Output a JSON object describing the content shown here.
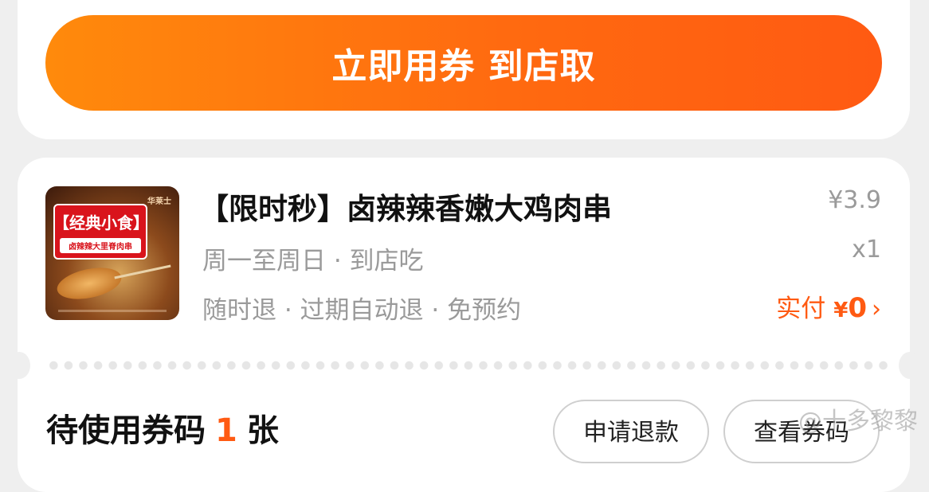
{
  "cta": {
    "label": "立即用券 到店取"
  },
  "product": {
    "title": "【限时秒】卤辣辣香嫩大鸡肉串",
    "schedule": "周一至周日 · 到店吃",
    "policy": "随时退 · 过期自动退 · 免预约",
    "price": "¥3.9",
    "quantity": "x1",
    "paid_label": "实付",
    "paid_currency": "¥",
    "paid_amount": "0",
    "thumbnail": {
      "brand": "华莱士",
      "tag_title": "【经典小食】",
      "tag_subtitle": "卤辣辣大里脊肉串"
    }
  },
  "codes": {
    "pending_prefix": "待使用券码",
    "pending_count": "1",
    "pending_suffix": "张",
    "refund_label": "申请退款",
    "view_label": "查看券码"
  },
  "watermark": "@十多黎黎",
  "colors": {
    "accent": "#ff5a12",
    "cta_gradient_start": "#ff8a0c",
    "cta_gradient_end": "#ff5a12",
    "muted_text": "#9a9a9a",
    "background": "#efefef"
  }
}
